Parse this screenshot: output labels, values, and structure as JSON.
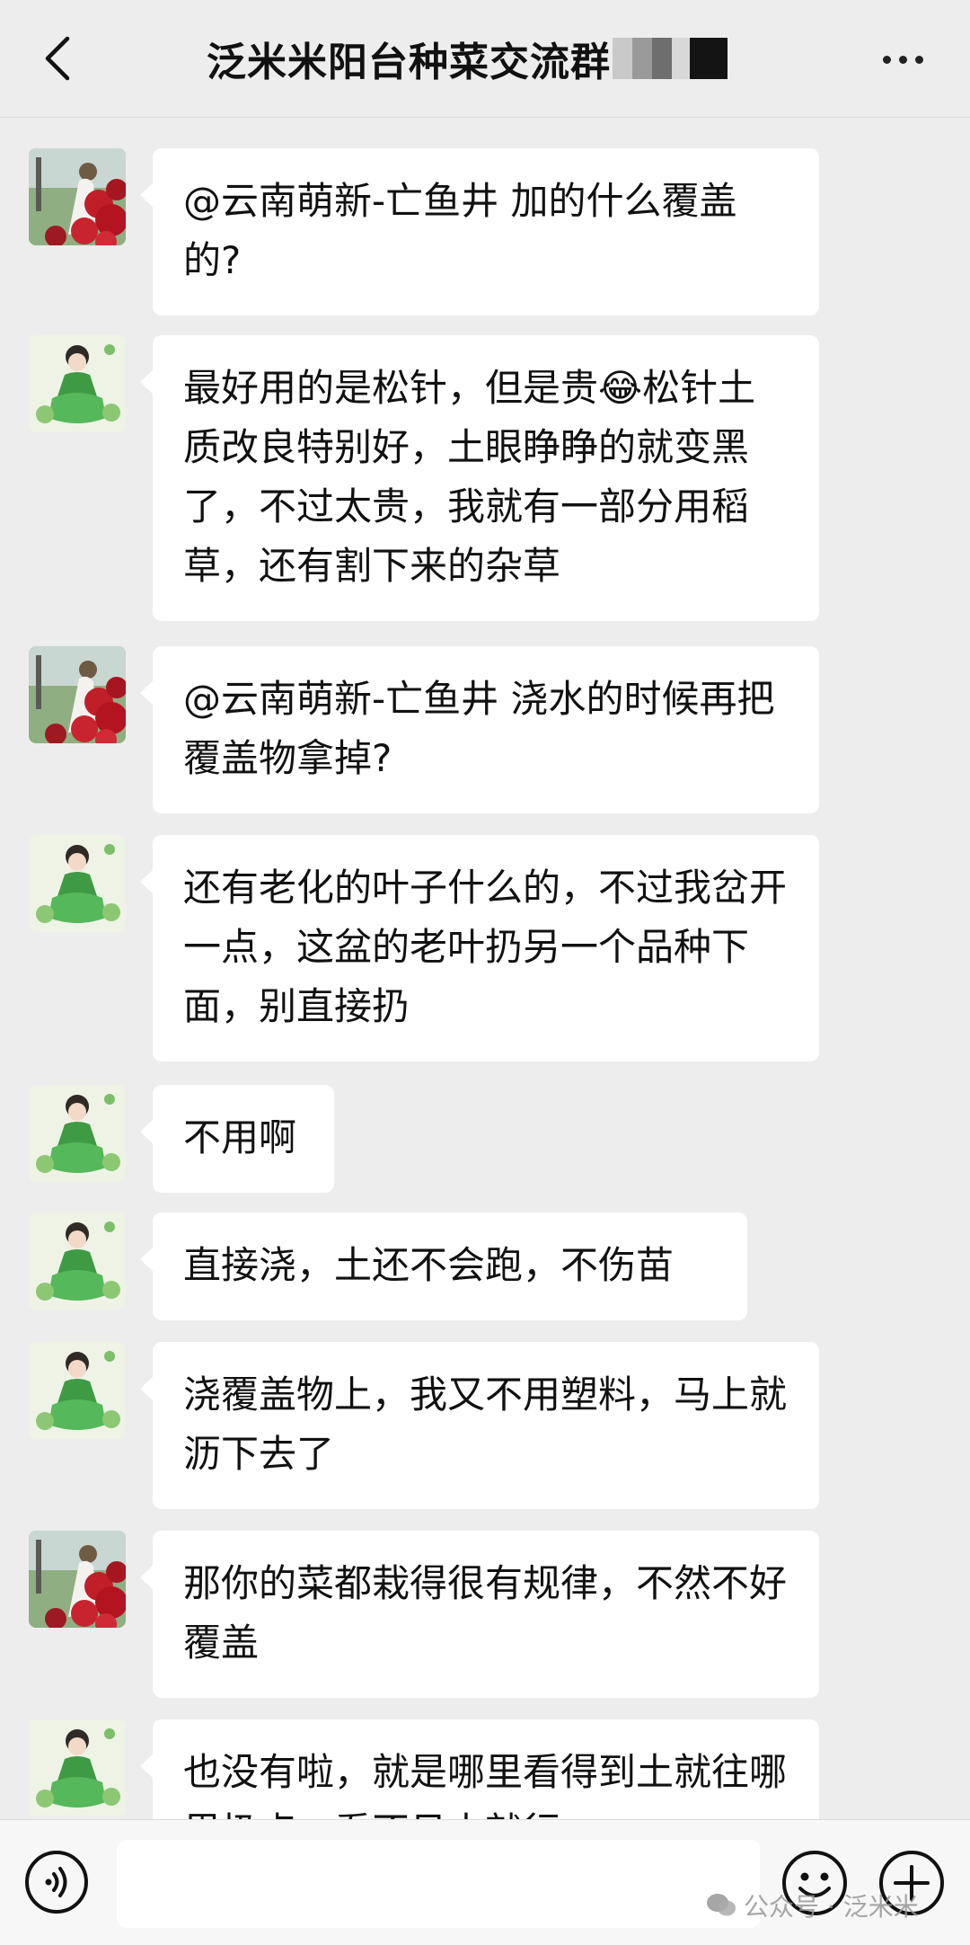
{
  "header": {
    "title": "泛米米阳台种菜交流群"
  },
  "messages": [
    {
      "avatar": "rose-garden-avatar",
      "text": "@云南萌新-亡鱼井  加的什么覆盖的?"
    },
    {
      "avatar": "green-dress-girl-avatar",
      "text": "最好用的是松针，但是贵😂松针土质改良特别好，土眼睁睁的就变黑了，不过太贵，我就有一部分用稻草，还有割下来的杂草"
    },
    {
      "avatar": "rose-garden-avatar",
      "text": "@云南萌新-亡鱼井  浇水的时候再把覆盖物拿掉?"
    },
    {
      "avatar": "green-dress-girl-avatar",
      "text": "还有老化的叶子什么的，不过我岔开一点，这盆的老叶扔另一个品种下面，别直接扔"
    },
    {
      "avatar": "green-dress-girl-avatar",
      "text": "不用啊"
    },
    {
      "avatar": "green-dress-girl-avatar",
      "text": "直接浇，土还不会跑，不伤苗"
    },
    {
      "avatar": "green-dress-girl-avatar",
      "text": "浇覆盖物上，我又不用塑料，马上就沥下去了"
    },
    {
      "avatar": "rose-garden-avatar",
      "text": "那你的菜都栽得很有规律，不然不好覆盖"
    },
    {
      "avatar": "green-dress-girl-avatar",
      "text": "也没有啦，就是哪里看得到土就往哪里扔点，看不见土就行"
    }
  ],
  "input": {
    "value": ""
  },
  "watermark": {
    "text": "公众号 · 泛米米"
  },
  "icons": {
    "back": "chevron-left-icon",
    "more": "more-dots-icon",
    "voice": "voice-icon",
    "emoji": "emoji-icon",
    "plus": "plus-icon"
  },
  "colors": {
    "background": "#ededed",
    "bubble": "#ffffff",
    "header": "#ededed",
    "bottom_bar": "#f7f7f7"
  }
}
